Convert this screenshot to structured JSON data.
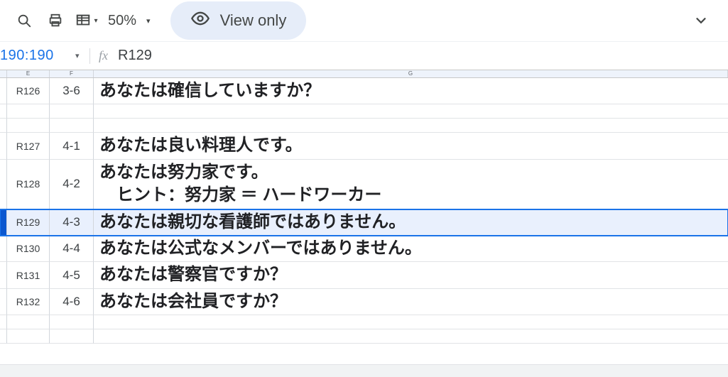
{
  "toolbar": {
    "zoom_label": "50%",
    "viewonly_label": "View only"
  },
  "namebox": {
    "ref": "190:190"
  },
  "formula_bar": {
    "value": "R129"
  },
  "column_letters": {
    "e": "E",
    "f": "F",
    "g": "G"
  },
  "rows": [
    {
      "id": "r126",
      "e": "R126",
      "f": "3-6",
      "g": "あなたは確信していますか？"
    },
    {
      "id": "blank1",
      "blank": true
    },
    {
      "id": "blank2",
      "blank": true
    },
    {
      "id": "r127",
      "e": "R127",
      "f": "4-1",
      "g": "あなたは良い料理人です。"
    },
    {
      "id": "r128",
      "e": "R128",
      "f": "4-2",
      "g": "あなたは努力家です。\n　ヒント：努力家 ＝ ハードワーカー",
      "multiline": true
    },
    {
      "id": "r129",
      "e": "R129",
      "f": "4-3",
      "g": "あなたは親切な看護師ではありません。",
      "selected": true
    },
    {
      "id": "r130",
      "e": "R130",
      "f": "4-4",
      "g": "あなたは公式なメンバーではありません。"
    },
    {
      "id": "r131",
      "e": "R131",
      "f": "4-5",
      "g": "あなたは警察官ですか？"
    },
    {
      "id": "r132",
      "e": "R132",
      "f": "4-6",
      "g": "あなたは会社員ですか？"
    },
    {
      "id": "blank3",
      "blank": true
    },
    {
      "id": "blank4",
      "blank": true
    }
  ]
}
